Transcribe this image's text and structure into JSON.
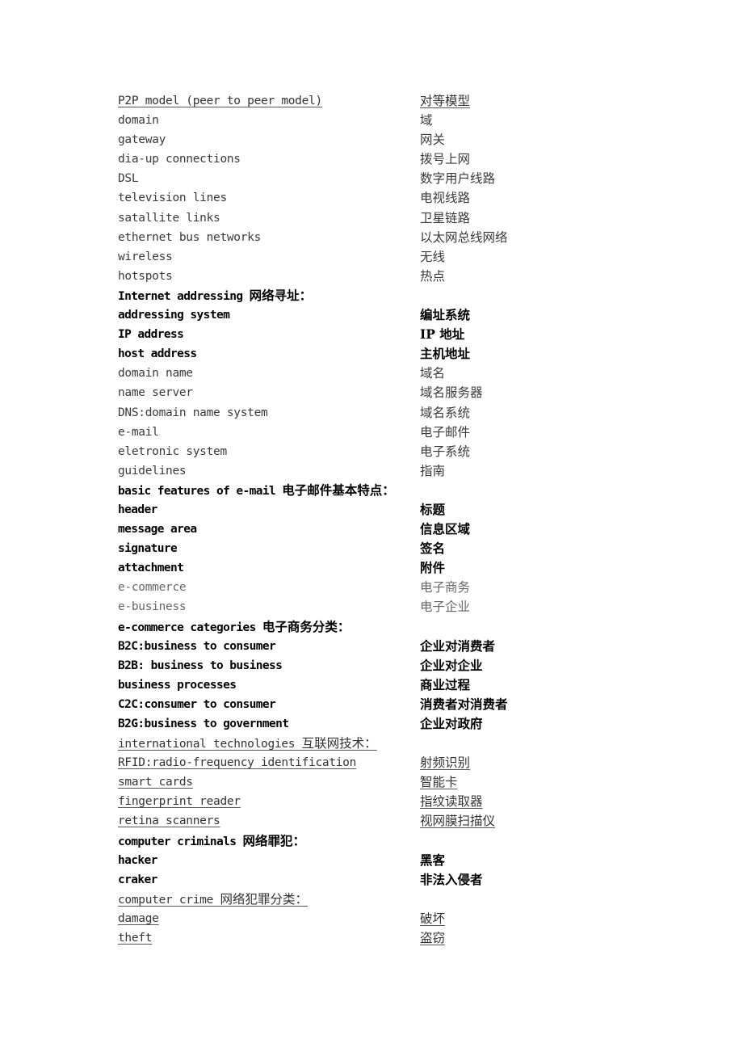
{
  "rows": [
    {
      "en": "P2P model (peer to peer model) ",
      "zh": "对等模型",
      "style": "link"
    },
    {
      "en": "domain",
      "zh": "域",
      "style": "plain"
    },
    {
      "en": "gateway",
      "zh": "网关",
      "style": "plain"
    },
    {
      "en": "dia-up connections",
      "zh": "拨号上网",
      "style": "plain"
    },
    {
      "en": "DSL",
      "zh": "数字用户线路",
      "style": "plain"
    },
    {
      "en": "television lines",
      "zh": "电视线路",
      "style": "plain"
    },
    {
      "en": "satallite links",
      "zh": "卫星链路",
      "style": "plain"
    },
    {
      "en": "ethernet bus networks",
      "zh": "以太网总线网络",
      "style": "plain"
    },
    {
      "en": "wireless",
      "zh": "无线",
      "style": "plain"
    },
    {
      "en": "hotspots",
      "zh": "热点",
      "style": "plain"
    },
    {
      "en": "Internet addressing ",
      "zh_inline": "网络寻址：",
      "style": "heading-bold"
    },
    {
      "en": "addressing system",
      "zh": "编址系统",
      "style": "bold"
    },
    {
      "en": "IP address",
      "zh": "IP 地址",
      "style": "bold"
    },
    {
      "en": "host address",
      "zh": "主机地址",
      "style": "bold"
    },
    {
      "en": "domain name",
      "zh": "域名",
      "style": "plain"
    },
    {
      "en": "name server",
      "zh": "域名服务器",
      "style": "plain"
    },
    {
      "en": "DNS:domain name system",
      "zh": "域名系统",
      "style": "plain"
    },
    {
      "en": "e-mail",
      "zh": "电子邮件",
      "style": "plain"
    },
    {
      "en": "eletronic system",
      "zh": "电子系统",
      "style": "plain"
    },
    {
      "en": "guidelines",
      "zh": "指南",
      "style": "plain"
    },
    {
      "en": "basic features of e-mail ",
      "zh_inline": "电子邮件基本特点：",
      "style": "heading-bold"
    },
    {
      "en": "header",
      "zh": "标题",
      "style": "bold"
    },
    {
      "en": "message area",
      "zh": "信息区域",
      "style": "bold"
    },
    {
      "en": "signature",
      "zh": "签名",
      "style": "bold"
    },
    {
      "en": "attachment",
      "zh": "附件",
      "style": "bold"
    },
    {
      "en": "e-commerce",
      "zh": "电子商务",
      "style": "faded"
    },
    {
      "en": "e-business",
      "zh": "电子企业",
      "style": "faded"
    },
    {
      "en": "e-commerce categories ",
      "zh_inline": "电子商务分类：",
      "style": "heading-bold"
    },
    {
      "en": "B2C:business to consumer",
      "zh": "企业对消费者",
      "style": "bold"
    },
    {
      "en": "B2B: business to business",
      "zh": "企业对企业",
      "style": "bold"
    },
    {
      "en": "business processes",
      "zh": "商业过程",
      "style": "bold"
    },
    {
      "en": "C2C:consumer to consumer",
      "zh": "消费者对消费者",
      "style": "bold"
    },
    {
      "en": "B2G:business to government",
      "zh": "企业对政府",
      "style": "bold"
    },
    {
      "en": "international technologies ",
      "zh_inline": "互联网技术： ",
      "style": "heading-link"
    },
    {
      "en": "RFID:radio-frequency identification",
      "zh": "射频识别",
      "style": "link"
    },
    {
      "en": "smart cards",
      "zh": "智能卡",
      "style": "link"
    },
    {
      "en": "fingerprint reader",
      "zh": "指纹读取器",
      "style": "link"
    },
    {
      "en": "retina scanners",
      "zh": "视网膜扫描仪",
      "style": "link"
    },
    {
      "en": "computer criminals ",
      "zh_inline": "网络罪犯：",
      "style": "heading-bold"
    },
    {
      "en": "hacker",
      "zh": "黑客",
      "style": "bold"
    },
    {
      "en": "craker",
      "zh": "非法入侵者",
      "style": "bold"
    },
    {
      "en": "computer crime ",
      "zh_inline": "网络犯罪分类： ",
      "style": "heading-link"
    },
    {
      "en": "damage",
      "zh": "破坏",
      "style": "link"
    },
    {
      "en": "theft",
      "zh": "盗窃",
      "style": "link"
    }
  ]
}
